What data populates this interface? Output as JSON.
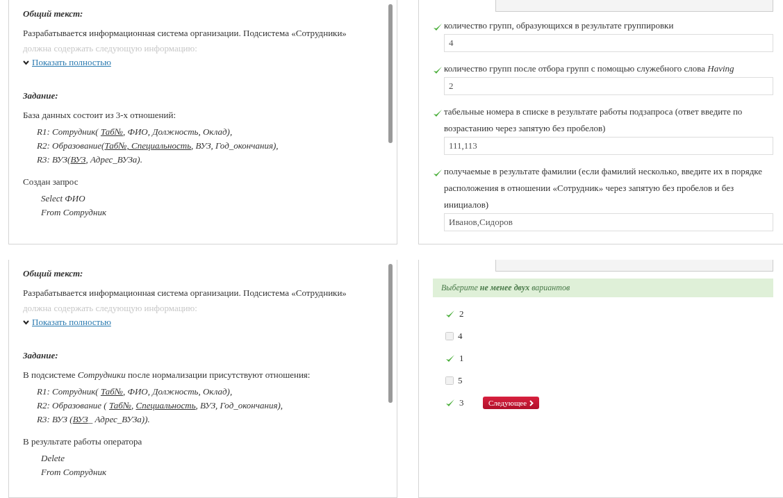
{
  "screens": [
    {
      "task_panel": {
        "common_heading": "Общий текст:",
        "intro": "Разрабатывается информационная система организации. Подсистема «Сотрудники»",
        "intro_faded": "должна содержать следующую информацию:",
        "toggle_link": "Показать полностью",
        "task_heading": "Задание:",
        "task_lines": [
          {
            "kind": "text",
            "text": "База данных состоит из 3-х отношений:"
          },
          {
            "kind": "formula",
            "segments": [
              {
                "text": "R1: Сотрудник( ",
                "underlined": false
              },
              {
                "text": "Таб№",
                "underlined": true
              },
              {
                "text": ", ФИО, Должность, Оклад),",
                "underlined": false
              }
            ]
          },
          {
            "kind": "formula",
            "segments": [
              {
                "text": "R2: Образование(",
                "underlined": false
              },
              {
                "text": "Таб№, Специальность",
                "underlined": true
              },
              {
                "text": ", ВУЗ, Год_окончания),",
                "underlined": false
              }
            ]
          },
          {
            "kind": "formula",
            "segments": [
              {
                "text": "R3: ВУЗ(",
                "underlined": false
              },
              {
                "text": "ВУЗ",
                "underlined": true
              },
              {
                "text": ", Адрес_ВУЗа).",
                "underlined": false
              }
            ]
          }
        ],
        "query_lines": [
          {
            "kind": "text",
            "text": "Создан запрос"
          },
          {
            "kind": "code",
            "text": "Select  ФИО"
          },
          {
            "kind": "code",
            "text": "From Сотрудник"
          }
        ]
      },
      "answer_panel": {
        "kind": "fields",
        "questions": [
          {
            "label": "количество групп, образующихся в результате группировки",
            "value": "4",
            "checked": true
          },
          {
            "label": "количество групп после отбора групп с помощью служебного слова *Having*",
            "value": "2",
            "checked": true
          },
          {
            "label": "табельные номера в списке в результате работы подзапроса (ответ введите по возрастанию через запятую без пробелов)",
            "value": "111,113",
            "checked": true
          },
          {
            "label": "получаемые в результате фамилии (если фамилий несколько, введите их в порядке расположения в отношении «Сотрудник» через запятую без пробелов и без инициалов)",
            "value": "Иванов,Сидоров",
            "checked": true
          }
        ]
      }
    },
    {
      "task_panel": {
        "common_heading": "Общий текст:",
        "intro": "Разрабатывается информационная система организации. Подсистема «Сотрудники»",
        "intro_faded": "должна содержать следующую информацию:",
        "toggle_link": "Показать полностью",
        "task_heading": "Задание:",
        "task_lines": [
          {
            "kind": "text",
            "text": "В подсистеме *Сотрудники* после нормализации присутствуют отношения:"
          },
          {
            "kind": "formula",
            "segments": [
              {
                "text": "R1: Сотрудник( ",
                "underlined": false
              },
              {
                "text": "Таб№",
                "underlined": true
              },
              {
                "text": ", ФИО, Должность, Оклад),",
                "underlined": false
              }
            ]
          },
          {
            "kind": "formula",
            "segments": [
              {
                "text": "R2: Образование ( ",
                "underlined": false
              },
              {
                "text": "Таб№",
                "underlined": true
              },
              {
                "text": ", ",
                "underlined": false
              },
              {
                "text": "Специальность",
                "underlined": true
              },
              {
                "text": ", ВУЗ, Год_окончания),",
                "underlined": false
              }
            ]
          },
          {
            "kind": "formula",
            "segments": [
              {
                "text": "R3: ВУЗ (",
                "underlined": false
              },
              {
                "text": "ВУЗ",
                "underlined": true
              },
              {
                "text": "_ Адрес_ВУЗа)).",
                "underlined": false
              }
            ]
          }
        ],
        "query_lines": [
          {
            "kind": "text",
            "text": "В результате работы оператора"
          },
          {
            "kind": "code",
            "text": "Delete"
          },
          {
            "kind": "code",
            "text": "From Сотрудник"
          }
        ]
      },
      "answer_panel": {
        "kind": "choices",
        "hint": "Выберите **не менее двух** вариантов",
        "next_button": "Следующее",
        "options": [
          {
            "label": "2",
            "checked": true
          },
          {
            "label": "4",
            "checked": false
          },
          {
            "label": "1",
            "checked": true
          },
          {
            "label": "5",
            "checked": false
          },
          {
            "label": "3",
            "checked": true
          }
        ]
      }
    }
  ]
}
